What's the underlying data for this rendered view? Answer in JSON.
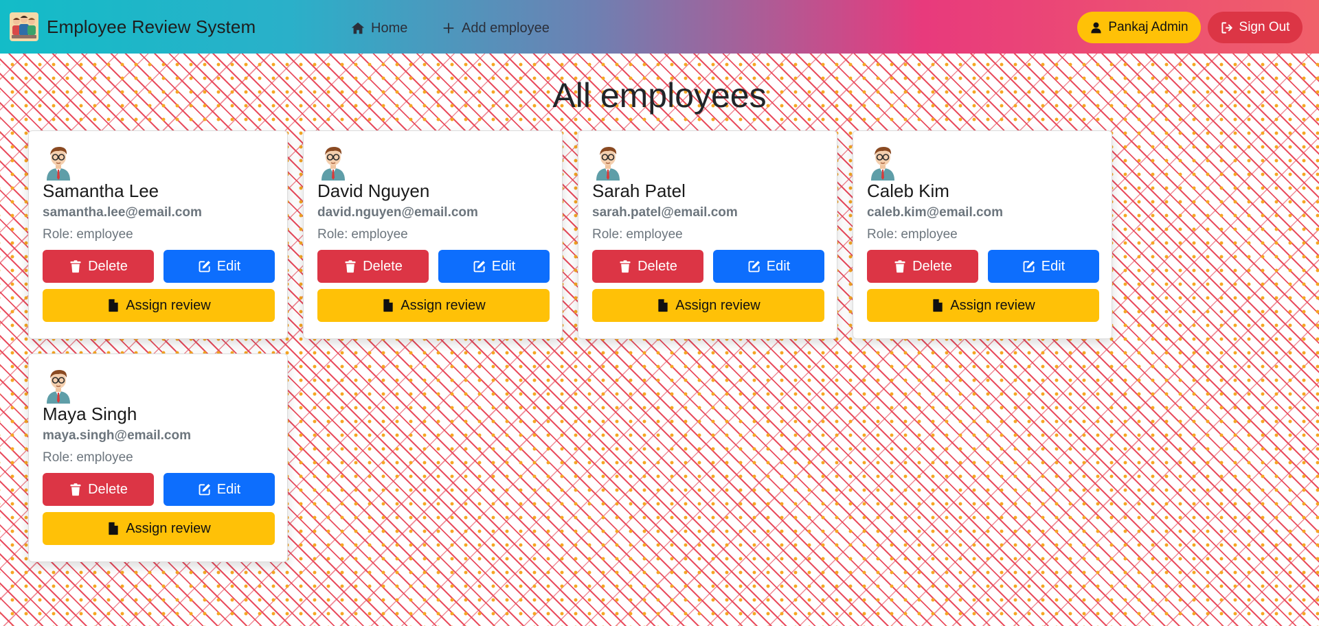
{
  "navbar": {
    "brand_title": "Employee Review System",
    "links": [
      {
        "label": "Home",
        "icon": "house-icon"
      },
      {
        "label": "Add employee",
        "icon": "plus-icon"
      }
    ],
    "user_button": "Pankaj Admin",
    "signout_button": "Sign Out"
  },
  "main": {
    "title": "All employees",
    "role_label": "Role:",
    "employees": [
      {
        "name": "Samantha Lee",
        "email": "samantha.lee@email.com",
        "role": "employee"
      },
      {
        "name": "David Nguyen",
        "email": "david.nguyen@email.com",
        "role": "employee"
      },
      {
        "name": "Sarah Patel",
        "email": "sarah.patel@email.com",
        "role": "employee"
      },
      {
        "name": "Caleb Kim",
        "email": "caleb.kim@email.com",
        "role": "employee"
      },
      {
        "name": "Maya Singh",
        "email": "maya.singh@email.com",
        "role": "employee"
      }
    ],
    "buttons": {
      "delete": "Delete",
      "edit": "Edit",
      "assign": "Assign review"
    }
  },
  "colors": {
    "danger": "#dc3545",
    "primary": "#0d6efd",
    "warning": "#ffc107"
  }
}
